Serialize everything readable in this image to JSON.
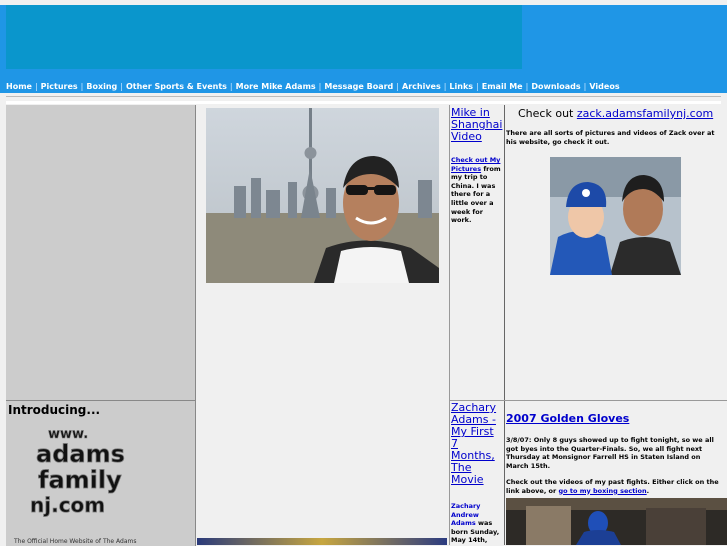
{
  "nav": {
    "items": [
      "Home",
      "Pictures",
      "Boxing",
      "Other Sports & Events",
      "More Mike Adams",
      "Message Board",
      "Archives",
      "Links",
      "Email Me",
      "Downloads",
      "Videos"
    ]
  },
  "left": {
    "intro_title": "Introducing...",
    "logo_lines": [
      "www.",
      "adams",
      "family",
      "nj.com"
    ],
    "logo_caption": "The Official Home Website of The Adams"
  },
  "shanghai": {
    "title": "Mike in Shanghai Video",
    "link_text": "Check out My Pictures",
    "body": " from my trip to China.  I was there for a little over a week for work."
  },
  "zack_site": {
    "prefix": "Check out ",
    "link": "zack.adamsfamilynj.com",
    "body": "There are all sorts of pictures and videos of Zack over at his website, go check it out."
  },
  "zack_movie": {
    "title": "Zachary Adams - My First 7 Months, The Movie",
    "name": "Zachary Andrew Adams",
    "body": " was born  Sunday, May 14th,"
  },
  "gloves": {
    "title": "2007 Golden Gloves",
    "para1": "3/8/07: Only 8 guys showed up to fight tonight, so we all got byes into the Quarter-Finals.  So, we all fight next Thursday at Monsignor Farrell HS in Staten Island on March 15th.",
    "para2_prefix": "Check out the videos of my past fights.  Either click on the link above, or ",
    "para2_link": "go to my boxing section",
    "para2_suffix": "."
  },
  "colors": {
    "header_strip": "#1f96e6",
    "header_banner": "#0a96cc",
    "link": "#0000cc",
    "sidebar": "#cccccc"
  }
}
